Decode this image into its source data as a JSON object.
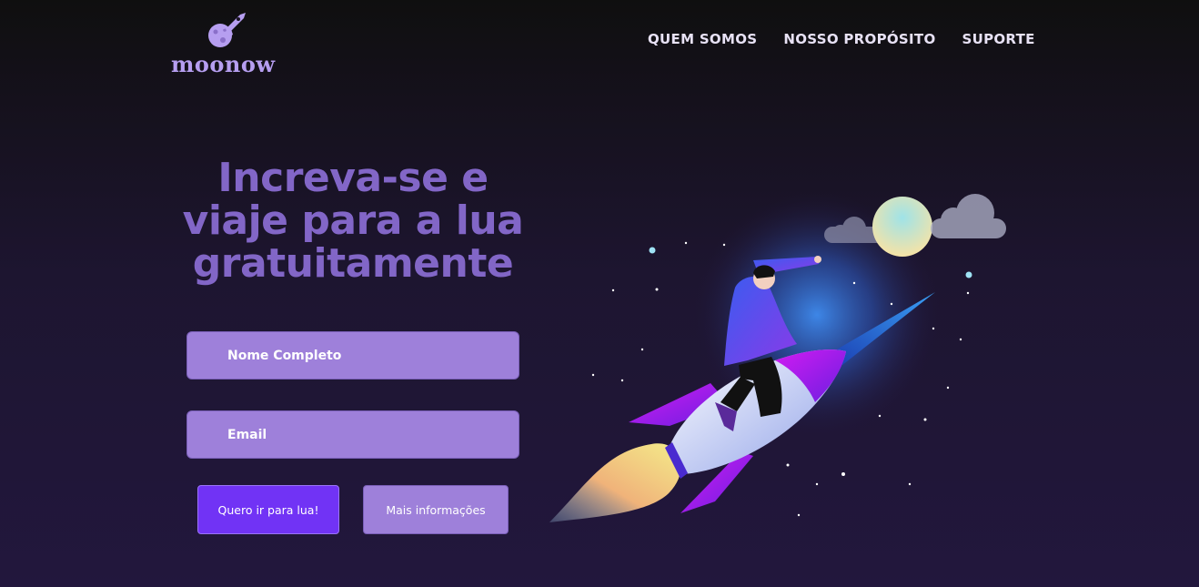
{
  "brand": {
    "name": "moonow",
    "icon": "moon-rocket-logo",
    "color": "#b69ef0"
  },
  "nav": {
    "items": [
      "QUEM SOMOS",
      "NOSSO PROPÓSITO",
      "SUPORTE"
    ]
  },
  "hero": {
    "headline": [
      "Increva-se e",
      "viaje para a lua",
      "gratuitamente"
    ],
    "headline_color": "#8266c7"
  },
  "form": {
    "name_placeholder": "Nome Completo",
    "email_placeholder": "Email",
    "primary_button": "Quero ir para lua!",
    "secondary_button": "Mais informações",
    "field_color": "#9e80da",
    "primary_color": "#7133f5"
  },
  "illustration": {
    "icon": "man-riding-rocket-to-moon-illustration"
  }
}
